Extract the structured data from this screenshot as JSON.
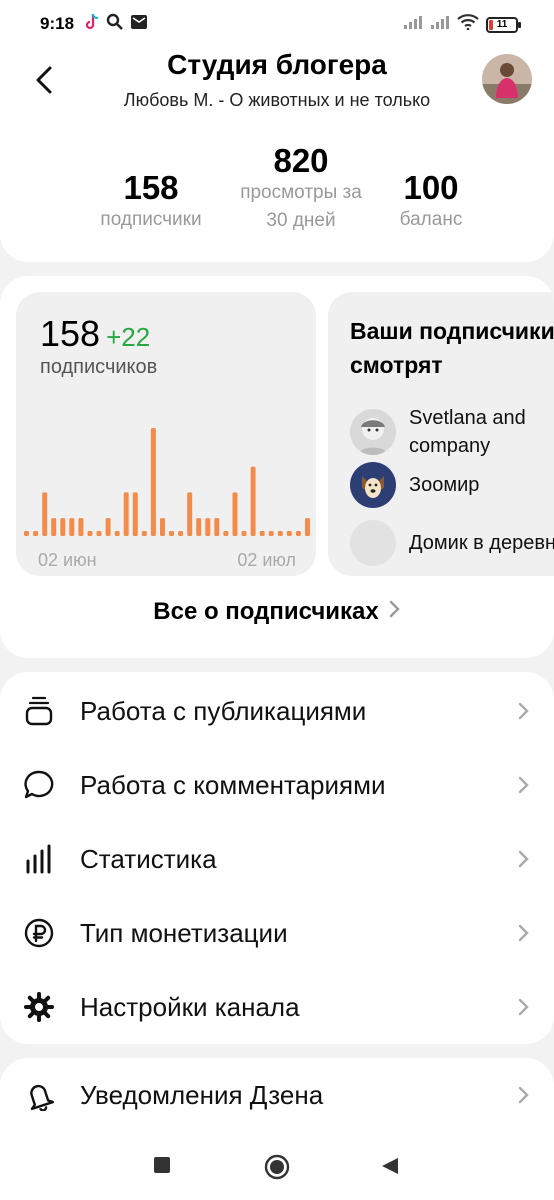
{
  "status_bar": {
    "time": "9:18",
    "battery": "11",
    "left_icons": [
      "tiktok-icon",
      "search-icon",
      "mail-icon"
    ],
    "right_icons": [
      "signal-icon",
      "signal-icon",
      "wifi-icon",
      "battery-icon"
    ]
  },
  "header": {
    "title": "Студия блогера",
    "subtitle": "Любовь М. - О животных и не только"
  },
  "stats": [
    {
      "value": "158",
      "label": "подписчики"
    },
    {
      "value": "820",
      "label": "просмотры за 30 дней"
    },
    {
      "value": "100",
      "label": "баланс"
    }
  ],
  "subscribers": {
    "count": "158",
    "delta": "+22",
    "label": "подписчиков",
    "x_labels": [
      "02 июн",
      "02 июл"
    ],
    "all_link": "Все о подписчиках"
  },
  "chart_data": {
    "type": "bar",
    "values": [
      0,
      0,
      3,
      1,
      1,
      1,
      1,
      0,
      0,
      1,
      0,
      3,
      3,
      0,
      8,
      1,
      0,
      0,
      3,
      1,
      1,
      1,
      0,
      3,
      0,
      5,
      0,
      0,
      0,
      0,
      0,
      1
    ],
    "color": "#f38b4b",
    "x_tick_labels": [
      "02 июн",
      "02 июл"
    ]
  },
  "watching": {
    "title": "Ваши подписчики\nсмотрят",
    "channels": [
      {
        "name": "Svetlana and company"
      },
      {
        "name": "Зоомир"
      },
      {
        "name": "Домик в деревне"
      }
    ]
  },
  "menu": [
    {
      "label": "Работа с публикациями",
      "icon": "publications-icon"
    },
    {
      "label": "Работа с комментариями",
      "icon": "comment-icon"
    },
    {
      "label": "Статистика",
      "icon": "statistics-icon"
    },
    {
      "label": "Тип монетизации",
      "icon": "ruble-icon"
    },
    {
      "label": "Настройки канала",
      "icon": "gear-icon"
    }
  ],
  "notifications": {
    "label": "Уведомления Дзена",
    "icon": "bell-icon"
  },
  "colors": {
    "accent_green": "#27a844",
    "bar": "#f38b4b",
    "muted": "#999999"
  }
}
